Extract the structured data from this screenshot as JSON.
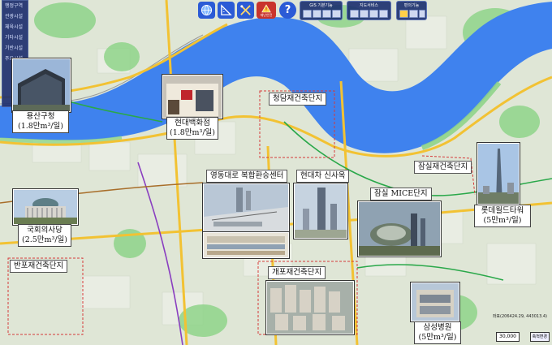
{
  "left_panel": {
    "items": [
      "행정구역",
      "관광시설",
      "체육시설",
      "기타시설",
      "기반시설",
      "주요시설"
    ]
  },
  "toolbar": {
    "center_label": "재난안전",
    "gis_title": "GIS 기본기능",
    "map_title": "지도서비스",
    "util_title": "편의기능"
  },
  "callouts": {
    "yongsan": [
      "용산구청",
      "(1.8만m³/일)"
    ],
    "hyundai_dept": [
      "현대백화점",
      "(1.8만m³/일)"
    ],
    "assembly": [
      "국회의사당",
      "(2.5만m³/일)"
    ],
    "lotte": [
      "롯데월드타워",
      "(5만m³/일)"
    ],
    "samsung": [
      "삼성병원",
      "(5만m³/일)"
    ]
  },
  "labels": {
    "cheongdam": "청담재건축단지",
    "jamsil_rebuild": "잠실재건축단지",
    "yeongdong": "영동대로 복합환승센터",
    "hyundai_car": "현대차 신사옥",
    "jamsil_mice": "잠실 MICE단지",
    "banpo": "반포재건축단지",
    "gaepo": "개포재건축단지"
  },
  "map_status": {
    "scale": "30,000",
    "scale_button": "축척변경",
    "coords": "좌표(206424.29, 443013.4)"
  },
  "colors": {
    "river": "#3f82ee",
    "park": "#8fd48a",
    "land": "#dfe6d6",
    "road_major": "#f2c233",
    "panel": "#1e306e"
  }
}
